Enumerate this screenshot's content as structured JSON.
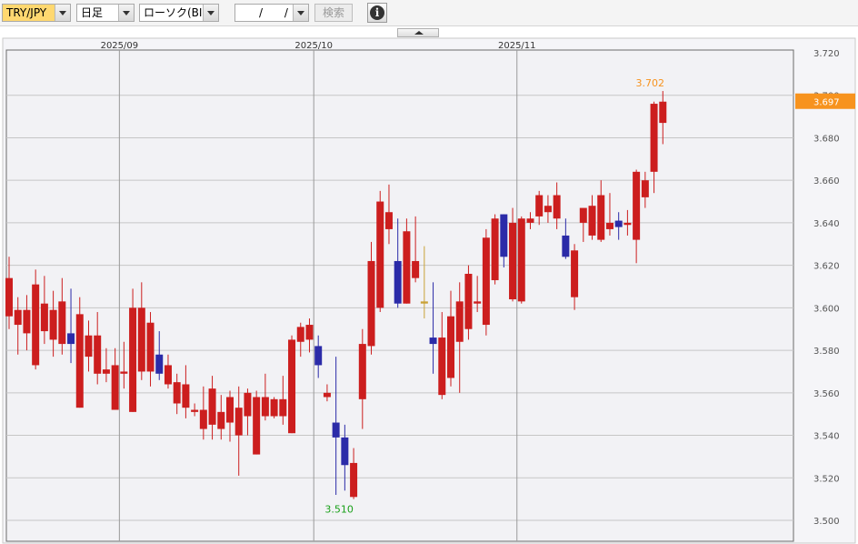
{
  "toolbar": {
    "pair": "TRY/JPY",
    "period": "日足",
    "chart_type": "ローソク(BID)",
    "date": "/ /",
    "search_label": "検索",
    "info_icon": "info-icon",
    "info_glyph": "i"
  },
  "colors": {
    "up": "#cc1e1e",
    "down": "#2b2ba8",
    "doji": "#c9a238",
    "current_price_bg": "#f7931e",
    "high_label": "#f7931e",
    "low_label": "#1aa01a"
  },
  "chart_data": {
    "type": "candlestick",
    "x_labels": [
      "2025/09",
      "2025/10",
      "2025/11"
    ],
    "y_ticks": [
      "3.720",
      "3.700",
      "3.680",
      "3.660",
      "3.640",
      "3.620",
      "3.600",
      "3.580",
      "3.560",
      "3.540",
      "3.520",
      "3.500"
    ],
    "ylim": [
      3.5,
      3.72
    ],
    "current_price": "3.697",
    "high_label": "3.702",
    "low_label": "3.510",
    "grid": true,
    "candles": [
      {
        "o": 3.596,
        "h": 3.624,
        "l": 3.59,
        "c": 3.614
      },
      {
        "o": 3.592,
        "h": 3.605,
        "l": 3.578,
        "c": 3.599
      },
      {
        "o": 3.588,
        "h": 3.606,
        "l": 3.58,
        "c": 3.599
      },
      {
        "o": 3.573,
        "h": 3.618,
        "l": 3.571,
        "c": 3.611
      },
      {
        "o": 3.589,
        "h": 3.615,
        "l": 3.583,
        "c": 3.602
      },
      {
        "o": 3.585,
        "h": 3.608,
        "l": 3.577,
        "c": 3.599
      },
      {
        "o": 3.583,
        "h": 3.614,
        "l": 3.578,
        "c": 3.603
      },
      {
        "o": 3.583,
        "h": 3.609,
        "l": 3.574,
        "c": 3.588,
        "dir": "down"
      },
      {
        "o": 3.553,
        "h": 3.605,
        "l": 3.553,
        "c": 3.597
      },
      {
        "o": 3.577,
        "h": 3.594,
        "l": 3.57,
        "c": 3.587
      },
      {
        "o": 3.569,
        "h": 3.598,
        "l": 3.564,
        "c": 3.587
      },
      {
        "o": 3.569,
        "h": 3.581,
        "l": 3.565,
        "c": 3.571
      },
      {
        "o": 3.552,
        "h": 3.581,
        "l": 3.552,
        "c": 3.573
      },
      {
        "o": 3.569,
        "h": 3.584,
        "l": 3.562,
        "c": 3.57
      },
      {
        "o": 3.551,
        "h": 3.609,
        "l": 3.551,
        "c": 3.6
      },
      {
        "o": 3.57,
        "h": 3.612,
        "l": 3.566,
        "c": 3.6
      },
      {
        "o": 3.57,
        "h": 3.598,
        "l": 3.563,
        "c": 3.593
      },
      {
        "o": 3.578,
        "h": 3.589,
        "l": 3.566,
        "c": 3.569,
        "dir": "down"
      },
      {
        "o": 3.564,
        "h": 3.578,
        "l": 3.562,
        "c": 3.573
      },
      {
        "o": 3.555,
        "h": 3.569,
        "l": 3.55,
        "c": 3.565
      },
      {
        "o": 3.553,
        "h": 3.573,
        "l": 3.548,
        "c": 3.564
      },
      {
        "o": 3.551,
        "h": 3.555,
        "l": 3.549,
        "c": 3.552
      },
      {
        "o": 3.543,
        "h": 3.563,
        "l": 3.538,
        "c": 3.552
      },
      {
        "o": 3.545,
        "h": 3.568,
        "l": 3.538,
        "c": 3.562
      },
      {
        "o": 3.543,
        "h": 3.559,
        "l": 3.538,
        "c": 3.551
      },
      {
        "o": 3.546,
        "h": 3.561,
        "l": 3.537,
        "c": 3.558
      },
      {
        "o": 3.54,
        "h": 3.563,
        "l": 3.521,
        "c": 3.553
      },
      {
        "o": 3.549,
        "h": 3.562,
        "l": 3.54,
        "c": 3.56
      },
      {
        "o": 3.531,
        "h": 3.561,
        "l": 3.531,
        "c": 3.558
      },
      {
        "o": 3.549,
        "h": 3.569,
        "l": 3.547,
        "c": 3.558
      },
      {
        "o": 3.549,
        "h": 3.558,
        "l": 3.548,
        "c": 3.557
      },
      {
        "o": 3.549,
        "h": 3.568,
        "l": 3.545,
        "c": 3.557
      },
      {
        "o": 3.541,
        "h": 3.587,
        "l": 3.541,
        "c": 3.585
      },
      {
        "o": 3.584,
        "h": 3.593,
        "l": 3.577,
        "c": 3.591
      },
      {
        "o": 3.585,
        "h": 3.595,
        "l": 3.579,
        "c": 3.592
      },
      {
        "o": 3.582,
        "h": 3.587,
        "l": 3.567,
        "c": 3.573,
        "dir": "down"
      },
      {
        "o": 3.558,
        "h": 3.564,
        "l": 3.556,
        "c": 3.56
      },
      {
        "o": 3.546,
        "h": 3.577,
        "l": 3.512,
        "c": 3.539,
        "dir": "down"
      },
      {
        "o": 3.539,
        "h": 3.545,
        "l": 3.514,
        "c": 3.526,
        "dir": "down"
      },
      {
        "o": 3.511,
        "h": 3.534,
        "l": 3.51,
        "c": 3.527
      },
      {
        "o": 3.557,
        "h": 3.59,
        "l": 3.543,
        "c": 3.583
      },
      {
        "o": 3.582,
        "h": 3.631,
        "l": 3.578,
        "c": 3.622
      },
      {
        "o": 3.6,
        "h": 3.655,
        "l": 3.598,
        "c": 3.65
      },
      {
        "o": 3.637,
        "h": 3.658,
        "l": 3.63,
        "c": 3.645
      },
      {
        "o": 3.622,
        "h": 3.642,
        "l": 3.6,
        "c": 3.602,
        "dir": "down"
      },
      {
        "o": 3.602,
        "h": 3.642,
        "l": 3.602,
        "c": 3.636
      },
      {
        "o": 3.614,
        "h": 3.643,
        "l": 3.612,
        "c": 3.622
      },
      {
        "o": 3.603,
        "h": 3.629,
        "l": 3.595,
        "c": 3.602,
        "doji": true
      },
      {
        "o": 3.586,
        "h": 3.612,
        "l": 3.569,
        "c": 3.583,
        "dir": "down"
      },
      {
        "o": 3.559,
        "h": 3.598,
        "l": 3.557,
        "c": 3.586
      },
      {
        "o": 3.567,
        "h": 3.608,
        "l": 3.563,
        "c": 3.596
      },
      {
        "o": 3.584,
        "h": 3.612,
        "l": 3.56,
        "c": 3.603
      },
      {
        "o": 3.59,
        "h": 3.62,
        "l": 3.585,
        "c": 3.616
      },
      {
        "o": 3.602,
        "h": 3.615,
        "l": 3.598,
        "c": 3.603
      },
      {
        "o": 3.592,
        "h": 3.637,
        "l": 3.587,
        "c": 3.633
      },
      {
        "o": 3.613,
        "h": 3.644,
        "l": 3.611,
        "c": 3.642
      },
      {
        "o": 3.644,
        "h": 3.644,
        "l": 3.619,
        "c": 3.624,
        "dir": "down"
      },
      {
        "o": 3.604,
        "h": 3.647,
        "l": 3.603,
        "c": 3.64
      },
      {
        "o": 3.603,
        "h": 3.643,
        "l": 3.602,
        "c": 3.642
      },
      {
        "o": 3.64,
        "h": 3.645,
        "l": 3.637,
        "c": 3.642
      },
      {
        "o": 3.643,
        "h": 3.655,
        "l": 3.639,
        "c": 3.653
      },
      {
        "o": 3.645,
        "h": 3.653,
        "l": 3.64,
        "c": 3.648
      },
      {
        "o": 3.642,
        "h": 3.659,
        "l": 3.637,
        "c": 3.653
      },
      {
        "o": 3.634,
        "h": 3.642,
        "l": 3.623,
        "c": 3.624,
        "dir": "down"
      },
      {
        "o": 3.605,
        "h": 3.63,
        "l": 3.599,
        "c": 3.627
      },
      {
        "o": 3.64,
        "h": 3.641,
        "l": 3.631,
        "c": 3.647
      },
      {
        "o": 3.634,
        "h": 3.653,
        "l": 3.632,
        "c": 3.648
      },
      {
        "o": 3.632,
        "h": 3.66,
        "l": 3.631,
        "c": 3.653
      },
      {
        "o": 3.637,
        "h": 3.654,
        "l": 3.634,
        "c": 3.64
      },
      {
        "o": 3.641,
        "h": 3.645,
        "l": 3.632,
        "c": 3.638,
        "dir": "down"
      },
      {
        "o": 3.64,
        "h": 3.646,
        "l": 3.634,
        "c": 3.639
      },
      {
        "o": 3.632,
        "h": 3.665,
        "l": 3.621,
        "c": 3.664
      },
      {
        "o": 3.652,
        "h": 3.664,
        "l": 3.647,
        "c": 3.66
      },
      {
        "o": 3.664,
        "h": 3.697,
        "l": 3.654,
        "c": 3.696
      },
      {
        "o": 3.687,
        "h": 3.702,
        "l": 3.677,
        "c": 3.697
      }
    ]
  }
}
